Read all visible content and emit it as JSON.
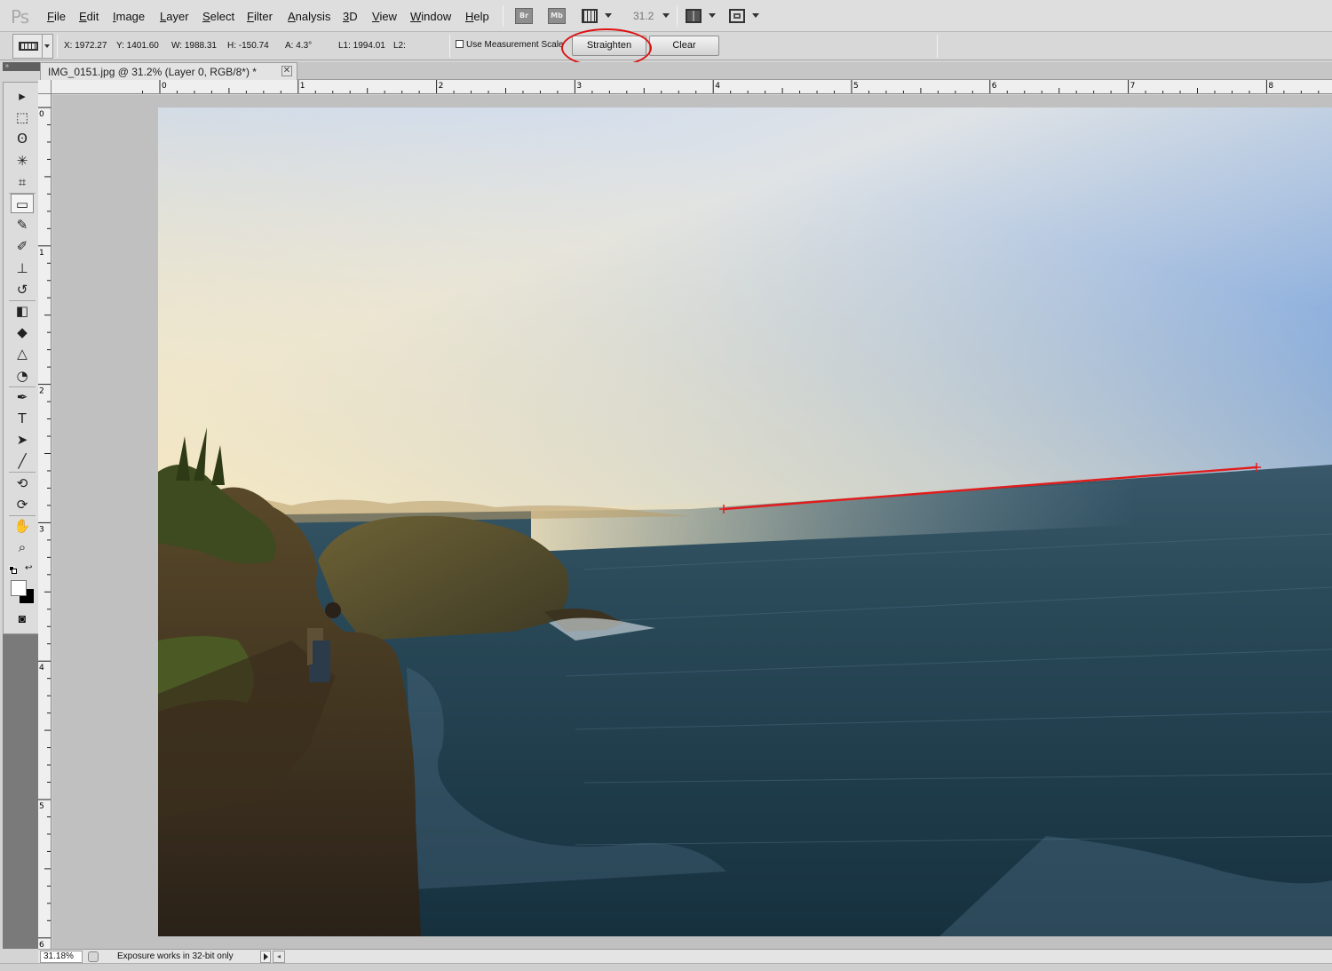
{
  "app": {
    "logo": "Ps"
  },
  "menu": {
    "items": [
      {
        "label": "File"
      },
      {
        "label": "Edit"
      },
      {
        "label": "Image"
      },
      {
        "label": "Layer"
      },
      {
        "label": "Select"
      },
      {
        "label": "Filter"
      },
      {
        "label": "Analysis"
      },
      {
        "label": "3D"
      },
      {
        "label": "View"
      },
      {
        "label": "Window"
      },
      {
        "label": "Help"
      }
    ],
    "bridge_label": "Br",
    "minibridge_label": "Mb",
    "zoom_value": "31.2"
  },
  "options": {
    "x": "X: 1972.27",
    "y": "Y: 1401.60",
    "w": "W: 1988.31",
    "h": "H: -150.74",
    "a": "A: 4.3°",
    "l1": "L1: 1994.01",
    "l2": "L2:",
    "use_measurement_scale": "Use Measurement Scale",
    "use_measurement_scale_checked": false,
    "straighten_label": "Straighten",
    "clear_label": "Clear",
    "highlight_color": "#d11111"
  },
  "document": {
    "tab_title": "IMG_0151.jpg @ 31.2% (Layer 0, RGB/8*) *",
    "close_glyph": "✕"
  },
  "rulers": {
    "top_labels": [
      "0",
      "1",
      "2",
      "3",
      "4",
      "5",
      "6",
      "7",
      "8"
    ],
    "left_labels": [
      "0",
      "1",
      "2",
      "3",
      "4",
      "5",
      "6"
    ]
  },
  "tools": [
    {
      "name": "move-tool-icon",
      "glyph": "▸"
    },
    {
      "name": "marquee-tool-icon",
      "glyph": "⬚"
    },
    {
      "name": "lasso-tool-icon",
      "glyph": "ʘ"
    },
    {
      "name": "magic-wand-tool-icon",
      "glyph": "✳"
    },
    {
      "name": "crop-tool-icon",
      "glyph": "⌗"
    },
    {
      "name": "ruler-tool-icon",
      "glyph": "▭",
      "active": true
    },
    {
      "name": "healing-brush-tool-icon",
      "glyph": "✎"
    },
    {
      "name": "brush-tool-icon",
      "glyph": "✐"
    },
    {
      "name": "clone-stamp-tool-icon",
      "glyph": "⊥"
    },
    {
      "name": "history-brush-tool-icon",
      "glyph": "↺"
    },
    {
      "name": "eraser-tool-icon",
      "glyph": "◧"
    },
    {
      "name": "paint-bucket-tool-icon",
      "glyph": "◆"
    },
    {
      "name": "blur-tool-icon",
      "glyph": "△"
    },
    {
      "name": "dodge-tool-icon",
      "glyph": "◔"
    },
    {
      "name": "pen-tool-icon",
      "glyph": "✒"
    },
    {
      "name": "type-tool-icon",
      "glyph": "T"
    },
    {
      "name": "path-selection-tool-icon",
      "glyph": "➤"
    },
    {
      "name": "line-tool-icon",
      "glyph": "╱"
    },
    {
      "name": "3d-rotate-tool-icon",
      "glyph": "⟲"
    },
    {
      "name": "3d-orbit-tool-icon",
      "glyph": "⟳"
    },
    {
      "name": "hand-tool-icon",
      "glyph": "✋"
    },
    {
      "name": "zoom-tool-icon",
      "glyph": "⌕"
    }
  ],
  "quick_mask_glyph": "◙",
  "status": {
    "zoom": "31.18%",
    "message": "Exposure works in 32-bit only",
    "scroll_glyph": "◂"
  }
}
